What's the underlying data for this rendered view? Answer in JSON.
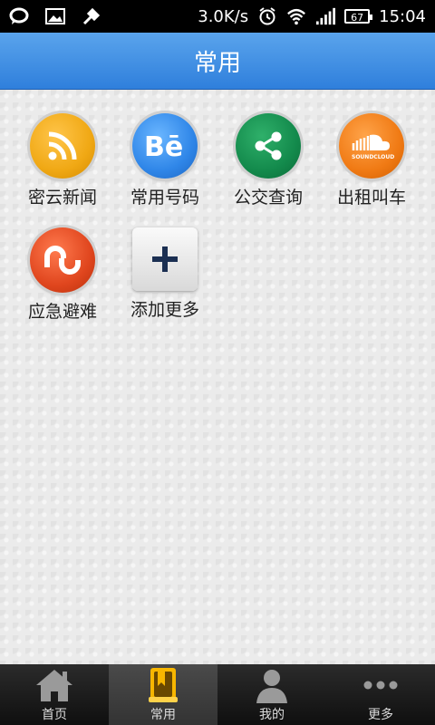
{
  "status_bar": {
    "speed": "3.0K/s",
    "battery": "67",
    "time": "15:04"
  },
  "header": {
    "title": "常用"
  },
  "apps": [
    {
      "label": "密云新闻",
      "icon": "rss-icon",
      "color": "#f0a814"
    },
    {
      "label": "常用号码",
      "icon": "behance-icon",
      "color": "#2f86e8"
    },
    {
      "label": "公交查询",
      "icon": "share-icon",
      "color": "#138a4c"
    },
    {
      "label": "出租叫车",
      "icon": "soundcloud-icon",
      "color": "#f07a14"
    },
    {
      "label": "应急避难",
      "icon": "stumbleupon-icon",
      "color": "#e0461e"
    },
    {
      "label": "添加更多",
      "icon": "plus-icon",
      "color": "#1b2f52"
    }
  ],
  "tabs": [
    {
      "label": "首页",
      "icon": "home-icon"
    },
    {
      "label": "常用",
      "icon": "bookmark-icon",
      "active": true
    },
    {
      "label": "我的",
      "icon": "user-icon"
    },
    {
      "label": "更多",
      "icon": "more-dots-icon"
    }
  ]
}
